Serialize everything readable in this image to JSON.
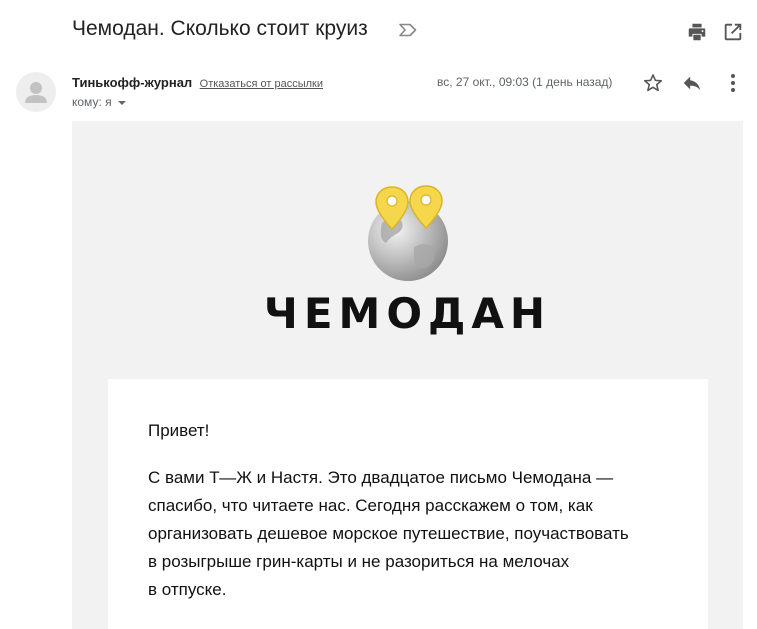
{
  "email": {
    "subject": "Чемодан. Сколько стоит круиз",
    "sender_name": "Тинькофф-журнал",
    "unsubscribe_label": "Отказаться от рассылки",
    "recipient": "кому: я",
    "date": "вс, 27 окт., 09:03 (1 день назад)"
  },
  "icons": {
    "label": "label-outline-icon",
    "print": "print-icon",
    "open_new_window": "open-in-new-window-icon",
    "star": "star-outline-icon",
    "reply": "reply-icon",
    "more": "more-vertical-icon",
    "avatar": "person-avatar-icon"
  },
  "newsletter": {
    "logo_text": "ЧЕМОДАН",
    "greeting": "Привет!",
    "lines": [
      "С вами Т—Ж и Настя. Это двадцатое письмо Чемодана —",
      "спасибо, что читаете нас. Сегодня расскажем о том, как",
      "организовать дешевое морское путешествие, поучаствовать",
      "в розыгрыше грин-карты и не разориться на мелочах",
      "в отпуске."
    ]
  },
  "colors": {
    "pin_yellow": "#f6d64a",
    "body_background": "#f2f2f2",
    "card_background": "#ffffff"
  }
}
